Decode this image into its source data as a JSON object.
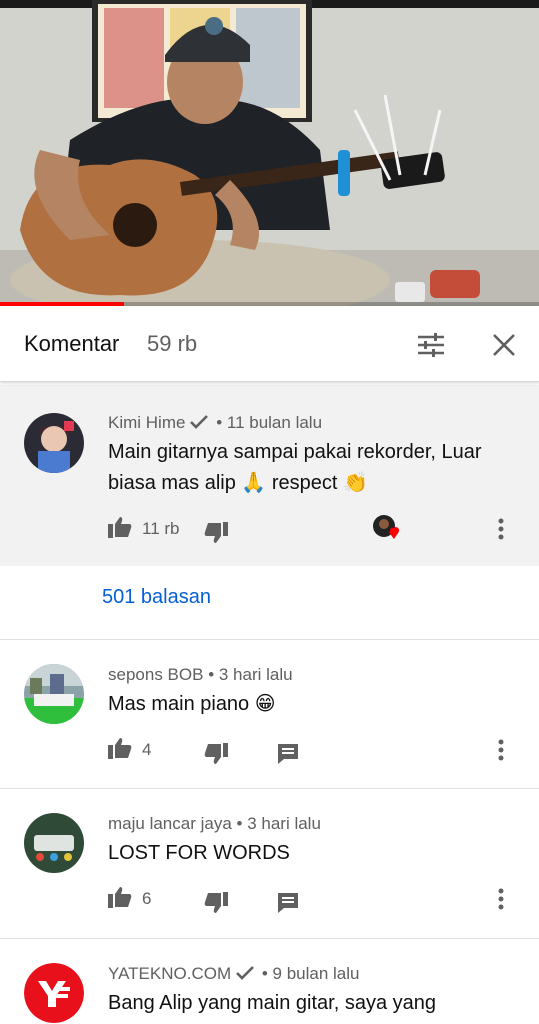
{
  "video": {
    "progress_fraction": 0.23
  },
  "header": {
    "title": "Komentar",
    "count": "59 rb",
    "icons": [
      "sort-icon",
      "close-icon"
    ]
  },
  "comments": [
    {
      "author": "Kimi Hime",
      "verified": true,
      "time": "11 bulan lalu",
      "text": "Main gitarnya sampai pakai rekorder, Luar biasa mas alip 🙏 respect 👏",
      "likes": "11 rb",
      "creator_heart": true
    },
    {
      "author": "sepons BOB",
      "verified": false,
      "time": "3 hari lalu",
      "text": "Mas main piano 😁",
      "likes": "4"
    },
    {
      "author": "maju lancar jaya",
      "verified": false,
      "time": "3 hari lalu",
      "text": "LOST FOR WORDS",
      "likes": "6"
    },
    {
      "author": "YATEKNO.COM",
      "verified": true,
      "time": "9 bulan lalu",
      "text": "Bang Alip yang main gitar, saya yang"
    }
  ],
  "replies_label": "501 balasan",
  "separator": "•",
  "colors": {
    "accent_blue": "#065fd4",
    "progress_red": "#ff0000",
    "heart": "#ff0000",
    "muted": "#606060"
  }
}
